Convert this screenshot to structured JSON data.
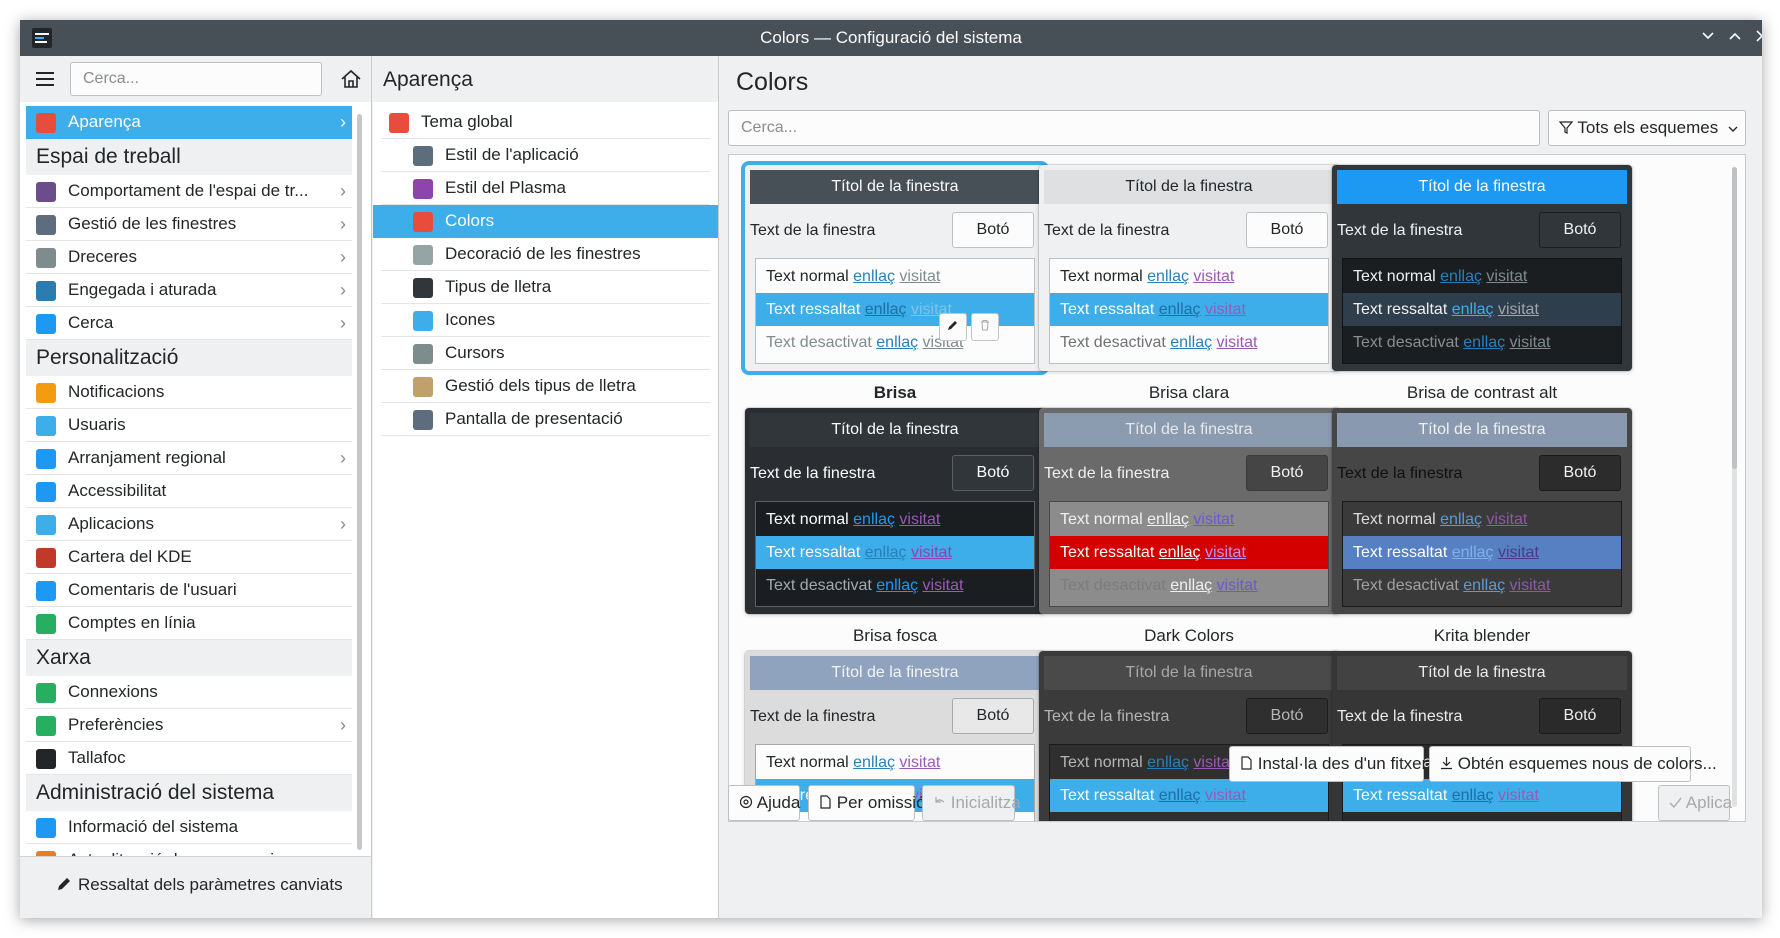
{
  "window": {
    "title": "Colors — Configuració del sistema"
  },
  "sidebar": {
    "search_placeholder": "Cerca...",
    "items": [
      {
        "type": "item",
        "label": "Aparença",
        "active": true,
        "chevron": true,
        "icon": "appearance-icon",
        "color": "#e74c3c"
      },
      {
        "type": "section",
        "label": "Espai de treball"
      },
      {
        "type": "item",
        "label": "Comportament de l'espai de tr...",
        "chevron": true,
        "icon": "workspace-icon",
        "color": "#6b4c8c"
      },
      {
        "type": "item",
        "label": "Gestió de les finestres",
        "chevron": true,
        "icon": "window-icon",
        "color": "#5d6d7e"
      },
      {
        "type": "item",
        "label": "Dreceres",
        "chevron": true,
        "icon": "keyboard-icon",
        "color": "#7f8c8d"
      },
      {
        "type": "item",
        "label": "Engegada i aturada",
        "chevron": true,
        "icon": "monitor-icon",
        "color": "#2c7cb0"
      },
      {
        "type": "item",
        "label": "Cerca",
        "chevron": true,
        "icon": "search-icon",
        "color": "#1d99f3"
      },
      {
        "type": "section",
        "label": "Personalització"
      },
      {
        "type": "item",
        "label": "Notificacions",
        "icon": "bell-icon",
        "color": "#f39c12"
      },
      {
        "type": "item",
        "label": "Usuaris",
        "icon": "users-icon",
        "color": "#3daee9"
      },
      {
        "type": "item",
        "label": "Arranjament regional",
        "chevron": true,
        "icon": "region-icon",
        "color": "#1d99f3"
      },
      {
        "type": "item",
        "label": "Accessibilitat",
        "icon": "accessibility-icon",
        "color": "#1d99f3"
      },
      {
        "type": "item",
        "label": "Aplicacions",
        "chevron": true,
        "icon": "applications-icon",
        "color": "#3daee9"
      },
      {
        "type": "item",
        "label": "Cartera del KDE",
        "icon": "wallet-icon",
        "color": "#c0392b"
      },
      {
        "type": "item",
        "label": "Comentaris de l'usuari",
        "icon": "feedback-icon",
        "color": "#1d99f3"
      },
      {
        "type": "item",
        "label": "Comptes en línia",
        "icon": "globe-icon",
        "color": "#27ae60"
      },
      {
        "type": "section",
        "label": "Xarxa"
      },
      {
        "type": "item",
        "label": "Connexions",
        "icon": "globe-icon",
        "color": "#27ae60"
      },
      {
        "type": "item",
        "label": "Preferències",
        "chevron": true,
        "icon": "globe-icon",
        "color": "#27ae60"
      },
      {
        "type": "item",
        "label": "Tallafoc",
        "icon": "firewall-icon",
        "color": "#232629"
      },
      {
        "type": "section",
        "label": "Administració del sistema"
      },
      {
        "type": "item",
        "label": "Informació del sistema",
        "icon": "info-icon",
        "color": "#1d99f3"
      },
      {
        "type": "item",
        "label": "Actualització de programari",
        "icon": "update-icon",
        "color": "#e67e22"
      }
    ],
    "highlight_button": "Ressaltat dels paràmetres canviats"
  },
  "middle": {
    "title": "Aparença",
    "items": [
      {
        "label": "Tema global",
        "icon": "global-theme-icon",
        "color": "#e74c3c",
        "indent": false
      },
      {
        "label": "Estil de l'aplicació",
        "icon": "app-style-icon",
        "color": "#5d6d7e",
        "indent": true
      },
      {
        "label": "Estil del Plasma",
        "icon": "plasma-style-icon",
        "color": "#8e44ad",
        "indent": true
      },
      {
        "label": "Colors",
        "icon": "colors-icon",
        "color": "#e74c3c",
        "indent": true,
        "active": true
      },
      {
        "label": "Decoració de les finestres",
        "icon": "window-decoration-icon",
        "color": "#95a5a6",
        "indent": true
      },
      {
        "label": "Tipus de lletra",
        "icon": "font-icon",
        "color": "#31363b",
        "indent": true
      },
      {
        "label": "Icones",
        "icon": "icons-icon",
        "color": "#3daee9",
        "indent": true
      },
      {
        "label": "Cursors",
        "icon": "cursor-icon",
        "color": "#7f8c8d",
        "indent": true
      },
      {
        "label": "Gestió dels tipus de lletra",
        "icon": "font-management-icon",
        "color": "#c0a16b",
        "indent": true
      },
      {
        "label": "Pantalla de presentació",
        "icon": "splash-icon",
        "color": "#5d6d7e",
        "indent": true
      }
    ]
  },
  "content": {
    "title": "Colors",
    "search_placeholder": "Cerca...",
    "filter_label": "Tots els esquemes",
    "preview_text": {
      "window_title": "Títol de la finestra",
      "window_text": "Text de la finestra",
      "button": "Botó",
      "normal": "Text normal",
      "selected": "Text ressaltat",
      "disabled": "Text desactivat",
      "link": "enllaç",
      "visited": "visitat"
    },
    "schemes": [
      {
        "name": "Brisa",
        "selected": true,
        "colors": {
          "frame": "#eff0f1",
          "title_bg": "#475057",
          "title_fg": "#fcfcfc",
          "win_fg": "#232629",
          "btn_bg": "#fcfcfc",
          "btn_fg": "#232629",
          "btn_border": "#bdc0c3",
          "view_bg": "#fcfcfc",
          "view_border": "#bdc0c3",
          "normal_fg": "#232629",
          "sel_bg": "#3daee9",
          "sel_fg": "#fcfcfc",
          "dis_fg": "#7f8c8d",
          "link": "#2980b9",
          "visited": "#7f8c8d",
          "sel_link": "#1d6fa5",
          "sel_visited": "#7fc4ea"
        }
      },
      {
        "name": "Brisa clara",
        "colors": {
          "frame": "#eff0f1",
          "title_bg": "#dee0e2",
          "title_fg": "#232629",
          "win_fg": "#232629",
          "btn_bg": "#fcfcfc",
          "btn_fg": "#232629",
          "btn_border": "#bdc0c3",
          "view_bg": "#fcfcfc",
          "view_border": "#bdc0c3",
          "normal_fg": "#232629",
          "sel_bg": "#3daee9",
          "sel_fg": "#fcfcfc",
          "dis_fg": "#6e7175",
          "link": "#2980b9",
          "visited": "#9b59b6",
          "sel_link": "#1d6fa5",
          "sel_visited": "#9b59b6"
        }
      },
      {
        "name": "Brisa de contrast alt",
        "colors": {
          "frame": "#31363b",
          "title_bg": "#1d99f3",
          "title_fg": "#fcfcfc",
          "win_fg": "#eff0f1",
          "btn_bg": "#31363b",
          "btn_fg": "#eff0f1",
          "btn_border": "#1b1d1f",
          "view_bg": "#1b1e20",
          "view_border": "#111314",
          "normal_fg": "#eff0f1",
          "sel_bg": "#2f3e4d",
          "sel_fg": "#eff0f1",
          "dis_fg": "#8a8d90",
          "link": "#2980b9",
          "visited": "#7f8c8d",
          "sel_link": "#3daee9",
          "sel_visited": "#a0a5aa"
        }
      },
      {
        "name": "Brisa fosca",
        "colors": {
          "frame": "#2a2e32",
          "title_bg": "#31363b",
          "title_fg": "#fcfcfc",
          "win_fg": "#fcfcfc",
          "btn_bg": "#31363b",
          "btn_fg": "#fcfcfc",
          "btn_border": "#5b6064",
          "view_bg": "#1b1e20",
          "view_border": "#5b6064",
          "normal_fg": "#fcfcfc",
          "sel_bg": "#3daee9",
          "sel_fg": "#fcfcfc",
          "dis_fg": "#a1a9b1",
          "link": "#1d99f3",
          "visited": "#9b59b6",
          "sel_link": "#2980b9",
          "sel_visited": "#8e44ad"
        }
      },
      {
        "name": "Dark Colors",
        "colors": {
          "frame": "#6a6a6a",
          "title_bg": "#8b9bb0",
          "title_fg": "#e8e8e8",
          "win_fg": "#f0f0f0",
          "btn_bg": "#454545",
          "btn_fg": "#f0f0f0",
          "btn_border": "#3a3a3a",
          "view_bg": "#8c8c8c",
          "view_border": "#4a4a4a",
          "normal_fg": "#f0f0f0",
          "sel_bg": "#d40000",
          "sel_fg": "#ffffff",
          "dis_fg": "#7c7c7c",
          "link": "#f0f0f0",
          "visited": "#6a5acd",
          "sel_link": "#ffffff",
          "sel_visited": "#bd93f9"
        }
      },
      {
        "name": "Krita blender",
        "colors": {
          "frame": "#464646",
          "title_bg": "#8899b0",
          "title_fg": "#f0f0f0",
          "win_fg": "#101010",
          "btn_bg": "#2c2c2c",
          "btn_fg": "#f0f0f0",
          "btn_border": "#1a1a1a",
          "view_bg": "#3a3a3a",
          "view_border": "#1a1a1a",
          "normal_fg": "#dcdcdc",
          "sel_bg": "#5680c2",
          "sel_fg": "#ffffff",
          "dis_fg": "#a0a0a0",
          "link": "#5a9bd4",
          "visited": "#8d5aa5",
          "sel_link": "#7fb1e8",
          "sel_visited": "#4a3a8a"
        }
      },
      {
        "name": "",
        "colors": {
          "frame": "#dcdcdc",
          "title_bg": "#8fa3bf",
          "title_fg": "#f4f4f4",
          "win_fg": "#232629",
          "btn_bg": "#e8e8e8",
          "btn_fg": "#232629",
          "btn_border": "#a8a8a8",
          "view_bg": "#fcfcfc",
          "view_border": "#a8a8a8",
          "normal_fg": "#232629",
          "sel_bg": "#3daee9",
          "sel_fg": "#fcfcfc",
          "dis_fg": "#8a8d90",
          "link": "#2980b9",
          "visited": "#9b59b6",
          "sel_link": "#1d6fa5",
          "sel_visited": "#9b59b6"
        }
      },
      {
        "name": "",
        "colors": {
          "frame": "#3b3b3b",
          "title_bg": "#4a4a4a",
          "title_fg": "#a8a8a8",
          "win_fg": "#b5b5b5",
          "btn_bg": "#2f2f2f",
          "btn_fg": "#b5b5b5",
          "btn_border": "#1c1c1c",
          "view_bg": "#2f2f2f",
          "view_border": "#1c1c1c",
          "normal_fg": "#b5b5b5",
          "sel_bg": "#3daee9",
          "sel_fg": "#fcfcfc",
          "dis_fg": "#808080",
          "link": "#2980b9",
          "visited": "#9b59b6",
          "sel_link": "#1d6fa5",
          "sel_visited": "#9b59b6"
        }
      },
      {
        "name": "",
        "colors": {
          "frame": "#363636",
          "title_bg": "#424242",
          "title_fg": "#ececec",
          "win_fg": "#ececec",
          "btn_bg": "#2a2a2a",
          "btn_fg": "#ececec",
          "btn_border": "#1a1a1a",
          "view_bg": "#2a2a2a",
          "view_border": "#1a1a1a",
          "normal_fg": "#ececec",
          "sel_bg": "#3daee9",
          "sel_fg": "#fcfcfc",
          "dis_fg": "#808080",
          "link": "#2980b9",
          "visited": "#9b59b6",
          "sel_link": "#1d6fa5",
          "sel_visited": "#9b59b6"
        }
      }
    ],
    "install_button": "Instal·la des d'un fitxer...",
    "get_new_button": "Obtén esquemes nous de colors...",
    "help_button": "Ajuda",
    "defaults_button": "Per omissió",
    "reset_button": "Inicialitza",
    "apply_button": "Aplica"
  }
}
